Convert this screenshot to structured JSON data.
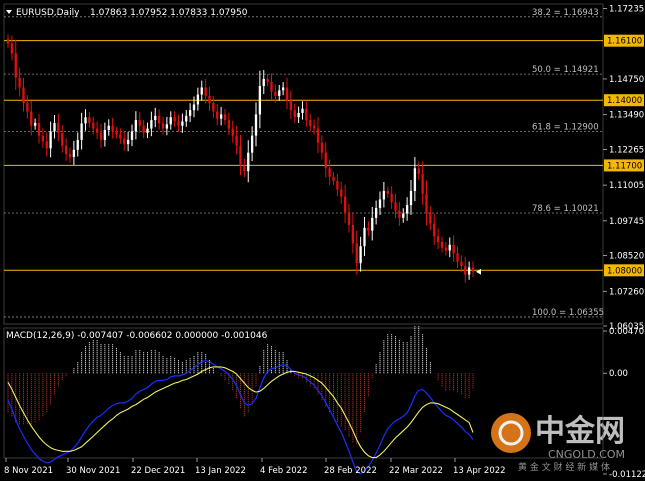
{
  "header": {
    "symbol": "EURUSD,Daily",
    "ohlc": "1.07863 1.07952 1.07833 1.07950"
  },
  "macd": {
    "label": "MACD(12,26,9) -0.007407 -0.006602 0.000000 -0.001046",
    "ticks": [
      {
        "v": 0.004705,
        "label": "0.004705"
      },
      {
        "v": 0.0,
        "label": "0.00"
      },
      {
        "v": -0.011227,
        "label": "-0.011227"
      }
    ]
  },
  "watermark": {
    "title": "中金网",
    "sub": "CNGOLD.COM",
    "slogan": "黄 金 文 财 经 新 媒 体"
  },
  "chart_data": {
    "type": "candlestick",
    "ylim": [
      1.06,
      1.175
    ],
    "y_ticks": [
      {
        "v": 1.17235,
        "label": "1.17235"
      },
      {
        "v": 1.1475,
        "label": "1.14750"
      },
      {
        "v": 1.1349,
        "label": "1.13490"
      },
      {
        "v": 1.12265,
        "label": "1.12265"
      },
      {
        "v": 1.11005,
        "label": "1.11005"
      },
      {
        "v": 1.09745,
        "label": "1.09745"
      },
      {
        "v": 1.0852,
        "label": "1.08520"
      },
      {
        "v": 1.0726,
        "label": "1.07260"
      },
      {
        "v": 1.06035,
        "label": "1.06035"
      }
    ],
    "horizontal_levels": [
      {
        "v": 1.161,
        "label": "1.16100",
        "color": "#f5b800"
      },
      {
        "v": 1.14,
        "label": "1.14000",
        "color": "#f5b800"
      },
      {
        "v": 1.117,
        "label": "1.11700",
        "color": "#f5b800"
      },
      {
        "v": 1.08,
        "label": "1.08000",
        "color": "#f5b800"
      }
    ],
    "fib_levels": [
      {
        "v": 1.16943,
        "label": "38.2 = 1.16943"
      },
      {
        "v": 1.14921,
        "label": "50.0 = 1.14921"
      },
      {
        "v": 1.129,
        "label": "61.8 = 1.12900"
      },
      {
        "v": 1.10021,
        "label": "78.6 = 1.10021"
      },
      {
        "v": 1.06355,
        "label": "100.0 = 1.06355"
      }
    ],
    "x_labels": [
      "8 Nov 2021",
      "30 Nov 2021",
      "22 Dec 2021",
      "13 Jan 2022",
      "4 Feb 2022",
      "28 Feb 2022",
      "22 Mar 2022",
      "13 Apr 2022"
    ],
    "colors": {
      "up": "#ffffff",
      "down": "#e01010",
      "macd_line": "#1a2eff",
      "signal_line": "#f0f060",
      "hist_pos": "#ffffff",
      "hist_neg": "#e03030"
    },
    "closes": [
      1.16,
      1.1565,
      1.148,
      1.1445,
      1.139,
      1.136,
      1.131,
      1.132,
      1.1275,
      1.1255,
      1.123,
      1.129,
      1.132,
      1.1285,
      1.124,
      1.121,
      1.12,
      1.1225,
      1.126,
      1.1318,
      1.134,
      1.132,
      1.13,
      1.1285,
      1.126,
      1.1295,
      1.131,
      1.129,
      1.128,
      1.1265,
      1.1245,
      1.126,
      1.129,
      1.133,
      1.131,
      1.1285,
      1.13,
      1.133,
      1.1345,
      1.1318,
      1.13,
      1.1315,
      1.134,
      1.1325,
      1.131,
      1.1325,
      1.1345,
      1.1365,
      1.1385,
      1.142,
      1.1445,
      1.1415,
      1.139,
      1.136,
      1.1335,
      1.135,
      1.133,
      1.13,
      1.1275,
      1.124,
      1.117,
      1.115,
      1.1215,
      1.1275,
      1.135,
      1.145,
      1.1475,
      1.1465,
      1.143,
      1.1415,
      1.1435,
      1.1445,
      1.14,
      1.1365,
      1.134,
      1.1355,
      1.137,
      1.133,
      1.131,
      1.13,
      1.125,
      1.1215,
      1.116,
      1.113,
      1.1115,
      1.1085,
      1.106,
      1.1005,
      1.096,
      1.0895,
      1.0825,
      1.0885,
      1.095,
      1.094,
      1.0985,
      1.102,
      1.105,
      1.108,
      1.107,
      1.104,
      1.101,
      1.0985,
      1.1,
      1.103,
      1.108,
      1.116,
      1.114,
      1.107,
      1.1,
      1.0965,
      1.092,
      1.09,
      1.088,
      1.087,
      1.089,
      1.086,
      1.083,
      1.0815,
      1.0785,
      1.081,
      1.0795
    ],
    "macd_values": [
      -0.003,
      -0.004,
      -0.0052,
      -0.0062,
      -0.007,
      -0.0078,
      -0.0085,
      -0.009,
      -0.0095,
      -0.0098,
      -0.01,
      -0.0099,
      -0.0096,
      -0.0093,
      -0.0091,
      -0.0089,
      -0.0087,
      -0.0083,
      -0.0078,
      -0.0071,
      -0.0064,
      -0.0058,
      -0.0053,
      -0.0049,
      -0.0047,
      -0.0043,
      -0.0039,
      -0.0036,
      -0.0034,
      -0.0033,
      -0.0033,
      -0.0031,
      -0.0028,
      -0.0023,
      -0.002,
      -0.0018,
      -0.0016,
      -0.0012,
      -0.0009,
      -0.0008,
      -0.0008,
      -0.0007,
      -0.0004,
      -0.0003,
      -0.0003,
      -0.0002,
      0.0,
      0.0003,
      0.0006,
      0.001,
      0.0013,
      0.0014,
      0.0013,
      0.001,
      0.0007,
      0.0005,
      0.0002,
      -0.0002,
      -0.0007,
      -0.0014,
      -0.0024,
      -0.0033,
      -0.0036,
      -0.0034,
      -0.0028,
      -0.0016,
      -0.0005,
      0.0002,
      0.0005,
      0.0006,
      0.0008,
      0.001,
      0.0008,
      0.0004,
      0.0,
      -0.0002,
      -0.0003,
      -0.0006,
      -0.001,
      -0.0013,
      -0.0019,
      -0.0025,
      -0.0033,
      -0.0041,
      -0.0049,
      -0.0058,
      -0.0066,
      -0.0076,
      -0.0087,
      -0.0099,
      -0.011,
      -0.0112,
      -0.0108,
      -0.0104,
      -0.0097,
      -0.0089,
      -0.008,
      -0.007,
      -0.0062,
      -0.0057,
      -0.0053,
      -0.0051,
      -0.0048,
      -0.0044,
      -0.0036,
      -0.0025,
      -0.0019,
      -0.0018,
      -0.0022,
      -0.0027,
      -0.0033,
      -0.0038,
      -0.0043,
      -0.0047,
      -0.0049,
      -0.0052,
      -0.0056,
      -0.006,
      -0.0065,
      -0.0068,
      -0.0074
    ],
    "signal_values": [
      -0.001,
      -0.0018,
      -0.0027,
      -0.0036,
      -0.0044,
      -0.0052,
      -0.0059,
      -0.0065,
      -0.0071,
      -0.0076,
      -0.008,
      -0.0083,
      -0.0085,
      -0.0086,
      -0.0087,
      -0.0087,
      -0.0087,
      -0.0086,
      -0.0084,
      -0.0082,
      -0.0078,
      -0.0074,
      -0.007,
      -0.0066,
      -0.0062,
      -0.0058,
      -0.0054,
      -0.0051,
      -0.0047,
      -0.0044,
      -0.0042,
      -0.004,
      -0.0037,
      -0.0035,
      -0.0032,
      -0.0029,
      -0.0027,
      -0.0024,
      -0.0021,
      -0.0019,
      -0.0017,
      -0.0015,
      -0.0013,
      -0.0011,
      -0.001,
      -0.0008,
      -0.0007,
      -0.0005,
      -0.0003,
      -0.0001,
      0.0002,
      0.0004,
      0.0006,
      0.0007,
      0.0007,
      0.0007,
      0.0006,
      0.0004,
      0.0002,
      -0.0001,
      -0.0006,
      -0.0011,
      -0.0016,
      -0.0019,
      -0.0021,
      -0.002,
      -0.0017,
      -0.0013,
      -0.0009,
      -0.0006,
      -0.0003,
      -0.0001,
      0.0001,
      0.0002,
      0.0002,
      0.0001,
      0.0,
      -0.0001,
      -0.0003,
      -0.0005,
      -0.0008,
      -0.0011,
      -0.0016,
      -0.0021,
      -0.0026,
      -0.0033,
      -0.0039,
      -0.0047,
      -0.0055,
      -0.0064,
      -0.0074,
      -0.0082,
      -0.0088,
      -0.0092,
      -0.0094,
      -0.0094,
      -0.0091,
      -0.0087,
      -0.0082,
      -0.0077,
      -0.0072,
      -0.0068,
      -0.0064,
      -0.006,
      -0.0055,
      -0.0049,
      -0.0043,
      -0.0038,
      -0.0035,
      -0.0033,
      -0.0033,
      -0.0034,
      -0.0036,
      -0.0038,
      -0.004,
      -0.0043,
      -0.0046,
      -0.0049,
      -0.0052,
      -0.0055,
      -0.0066
    ]
  }
}
